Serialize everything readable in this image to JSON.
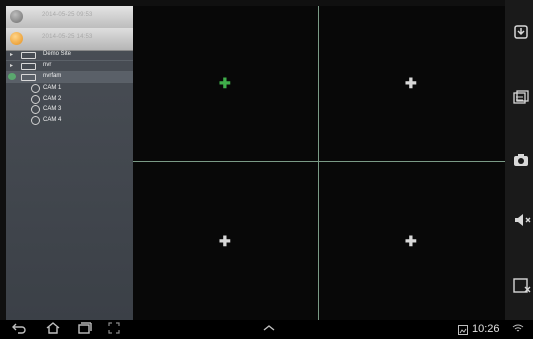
{
  "header_rows": [
    {
      "text": "2014-05-25 09:53",
      "dot_color": "#8a8a8a"
    },
    {
      "text": "2014-05-25 14:53",
      "dot_color": "#f2a93b"
    }
  ],
  "devices": [
    {
      "label": "Demo Site"
    },
    {
      "label": "nvr"
    },
    {
      "label": "nvrfam"
    }
  ],
  "cameras": [
    {
      "label": "CAM 1"
    },
    {
      "label": "CAM 2"
    },
    {
      "label": "CAM 3"
    },
    {
      "label": "CAM 4"
    }
  ],
  "tiles": [
    {
      "name": "tile-1",
      "plus_color": "#3fae4a"
    },
    {
      "name": "tile-2",
      "plus_color": "#d8d8d8"
    },
    {
      "name": "tile-3",
      "plus_color": "#d8d8d8"
    },
    {
      "name": "tile-4",
      "plus_color": "#d8d8d8"
    }
  ],
  "toolbar_icons": [
    "playback-icon",
    "layout-icon",
    "camera-snapshot-icon",
    "mute-icon",
    "close-window-icon"
  ],
  "nav": {
    "time": "10:26"
  }
}
